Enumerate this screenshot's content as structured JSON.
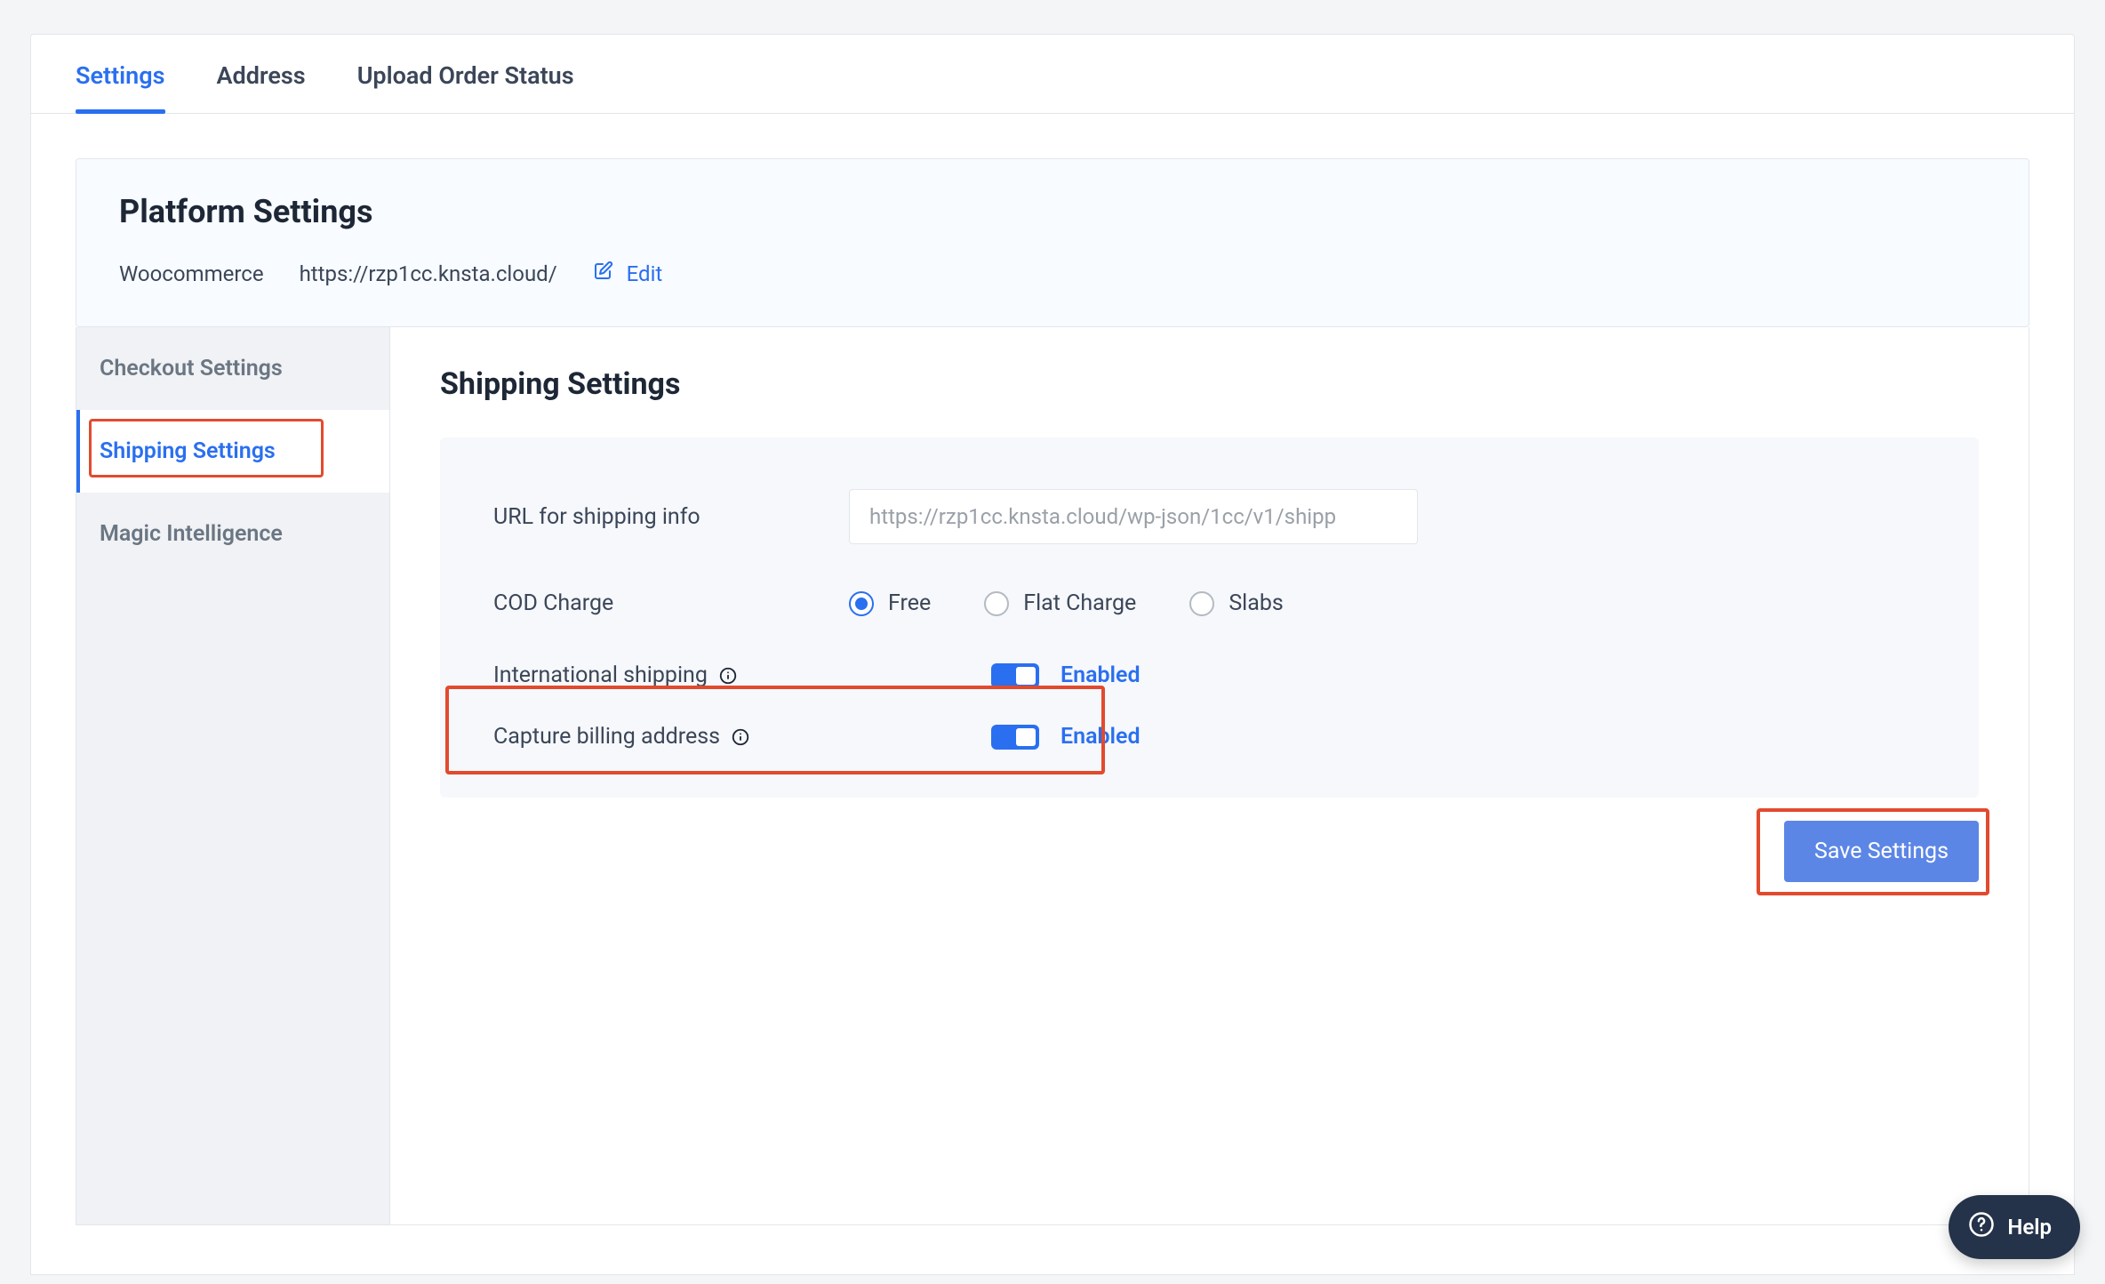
{
  "tabs": [
    {
      "label": "Settings",
      "active": true
    },
    {
      "label": "Address",
      "active": false
    },
    {
      "label": "Upload Order Status",
      "active": false
    }
  ],
  "platform": {
    "title": "Platform Settings",
    "name": "Woocommerce",
    "url": "https://rzp1cc.knsta.cloud/",
    "edit_label": "Edit"
  },
  "sidebar": {
    "items": [
      {
        "label": "Checkout Settings",
        "active": false
      },
      {
        "label": "Shipping Settings",
        "active": true
      },
      {
        "label": "Magic Intelligence",
        "active": false
      }
    ]
  },
  "section": {
    "title": "Shipping Settings",
    "url_label": "URL for shipping info",
    "url_value": "https://rzp1cc.knsta.cloud/wp-json/1cc/v1/shipp",
    "cod_label": "COD Charge",
    "cod_options": [
      {
        "label": "Free",
        "selected": true
      },
      {
        "label": "Flat Charge",
        "selected": false
      },
      {
        "label": "Slabs",
        "selected": false
      }
    ],
    "intl_label": "International shipping",
    "intl_enabled_label": "Enabled",
    "capture_label": "Capture billing address",
    "capture_enabled_label": "Enabled",
    "save_label": "Save Settings"
  },
  "help": {
    "label": "Help"
  },
  "colors": {
    "blue": "#2a6ff0",
    "annotation": "#e24a2e"
  }
}
